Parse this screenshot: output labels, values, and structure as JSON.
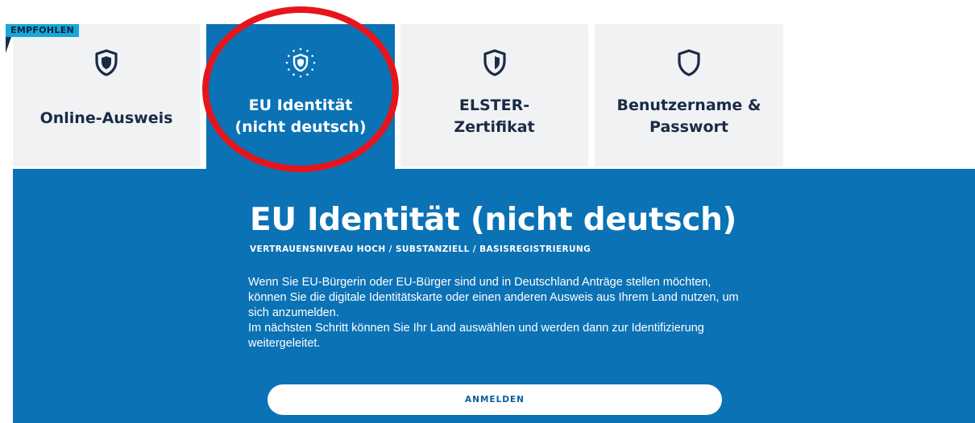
{
  "badge": "EMPFOHLEN",
  "tabs": [
    {
      "label": "Online-Ausweis",
      "icon": "shield-icon"
    },
    {
      "label": "EU Identität\n(nicht deutsch)",
      "icon": "eu-stars-shield-icon"
    },
    {
      "label": "ELSTER-\nZertifikat",
      "icon": "shield-half-icon"
    },
    {
      "label": "Benutzername &\nPasswort",
      "icon": "shield-outline-icon"
    }
  ],
  "panel": {
    "title": "EU Identität (nicht deutsch)",
    "subtitle": "VERTRAUENSNIVEAU HOCH / SUBSTANZIELL / BASISREGISTRIERUNG",
    "paragraph1": "Wenn Sie EU-Bürgerin oder EU-Bürger sind und in Deutschland Anträge stellen möchten, können Sie die digitale Identitätskarte oder einen anderen Ausweis aus Ihrem Land nutzen, um sich anzumelden.",
    "paragraph2": "Im nächsten Schritt können Sie Ihr Land auswählen und werden dann zur Identifizierung weitergeleitet.",
    "button": "ANMELDEN"
  },
  "colors": {
    "primary": "#0b72b5",
    "tab_bg": "#f1f2f4",
    "badge": "#18a7d8",
    "highlight": "#e8141b",
    "text_dark": "#1b2b46"
  }
}
